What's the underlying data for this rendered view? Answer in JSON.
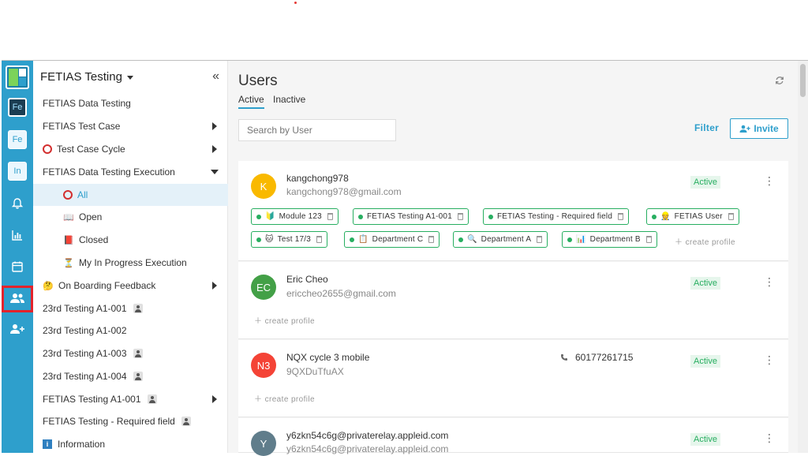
{
  "workspace": {
    "title": "FETIAS Testing"
  },
  "rail": {
    "items": [
      {
        "label": "Fe"
      },
      {
        "label": "Fe"
      },
      {
        "label": "In"
      }
    ]
  },
  "nav": {
    "items": [
      {
        "label": "FETIAS Data Testing"
      },
      {
        "label": "FETIAS Test Case"
      },
      {
        "label": "Test Case Cycle"
      },
      {
        "label": "FETIAS Data Testing Execution"
      },
      {
        "label": "All"
      },
      {
        "label": "Open"
      },
      {
        "label": "Closed"
      },
      {
        "label": "My In Progress Execution"
      },
      {
        "label": "On Boarding Feedback"
      },
      {
        "label": "23rd Testing A1-001"
      },
      {
        "label": "23rd Testing A1-002"
      },
      {
        "label": "23rd Testing A1-003"
      },
      {
        "label": "23rd Testing A1-004"
      },
      {
        "label": "FETIAS Testing A1-001"
      },
      {
        "label": "FETIAS Testing - Required field"
      },
      {
        "label": "Information"
      }
    ]
  },
  "main": {
    "title": "Users",
    "tabs": [
      {
        "label": "Active"
      },
      {
        "label": "Inactive"
      }
    ],
    "search_placeholder": "Search by User",
    "filter_label": "Filter",
    "invite_label": "Invite",
    "create_profile_label": "create profile",
    "users": [
      {
        "initials": "K",
        "color": "#f9b900",
        "name": "kangchong978",
        "email": "kangchong978@gmail.com",
        "status": "Active",
        "profiles": [
          {
            "label": "Module 123",
            "emoji": "🔰"
          },
          {
            "label": "FETIAS Testing A1-001",
            "emoji": ""
          },
          {
            "label": "FETIAS Testing - Required field",
            "emoji": ""
          },
          {
            "label": "FETIAS User",
            "emoji": "👷"
          },
          {
            "label": "Test 17/3",
            "emoji": "🐱"
          },
          {
            "label": "Department C",
            "emoji": "📋"
          },
          {
            "label": "Department A",
            "emoji": "🔍"
          },
          {
            "label": "Department B",
            "emoji": "📊"
          }
        ]
      },
      {
        "initials": "EC",
        "color": "#43a047",
        "name": "Eric Cheo",
        "email": "ericcheo2655@gmail.com",
        "status": "Active"
      },
      {
        "initials": "N3",
        "color": "#f44336",
        "name": "NQX cycle 3 mobile",
        "email": "9QXDuTfuAX",
        "phone": "60177261715",
        "status": "Active"
      },
      {
        "initials": "Y",
        "color": "#607d8b",
        "name": "y6zkn54c6g@privaterelay.appleid.com",
        "email": "y6zkn54c6g@privaterelay.appleid.com",
        "status": "Active"
      }
    ]
  },
  "colors": {
    "accent": "#2e9fcc",
    "active_green": "#27ae60",
    "annotation_red": "#e3232c"
  }
}
